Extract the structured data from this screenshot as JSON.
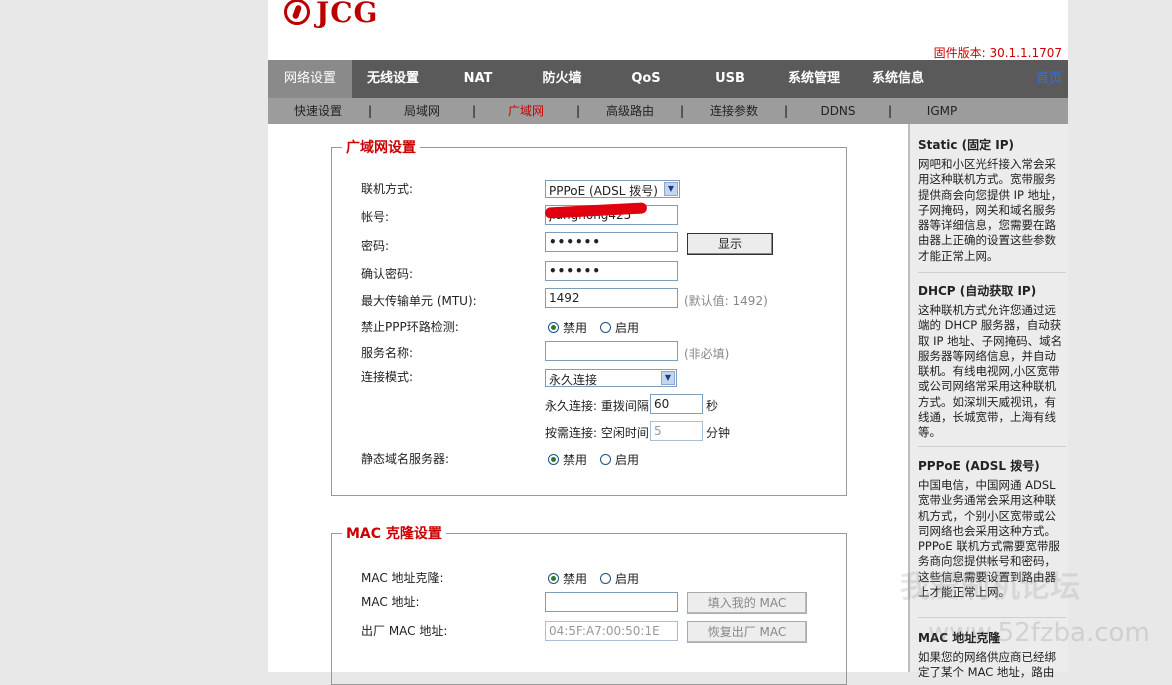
{
  "brand": {
    "logo_text": "JCG"
  },
  "firmware": "固件版本: 30.1.1.1707",
  "nav_main": [
    "网络设置",
    "无线设置",
    "NAT",
    "防火墙",
    "QoS",
    "USB",
    "系统管理",
    "系统信息"
  ],
  "nav_home": "首页",
  "nav_sub": [
    "快速设置",
    "局域网",
    "广域网",
    "高级路由",
    "连接参数",
    "DDNS",
    "IGMP"
  ],
  "nav_sep": "|",
  "wan": {
    "title": "广域网设置",
    "conn_type_label": "联机方式:",
    "conn_type_value": "PPPoE (ADSL 拨号)",
    "account_label": "帐号:",
    "account_value": "jiangnong425",
    "password_label": "密码:",
    "password_value": "••••••",
    "show_button": "显示",
    "confirm_label": "确认密码:",
    "confirm_value": "••••••",
    "mtu_label": "最大传输单元 (MTU):",
    "mtu_value": "1492",
    "mtu_hint": "(默认值: 1492)",
    "ppp_label": "禁止PPP环路检测:",
    "service_label": "服务名称:",
    "service_value": "",
    "service_hint": "(非必填)",
    "mode_label": "连接模式:",
    "mode_value": "永久连接",
    "redial_label": "永久连接: 重拨间隔",
    "redial_value": "60",
    "redial_unit": "秒",
    "idle_label": "按需连接: 空闲时间",
    "idle_value": "5",
    "idle_unit": "分钟",
    "static_dns_label": "静态域名服务器:",
    "disable": "禁用",
    "enable": "启用"
  },
  "mac": {
    "title": "MAC 克隆设置",
    "clone_label": "MAC 地址克隆:",
    "addr_label": "MAC 地址:",
    "addr_value": "",
    "fill_button": "填入我的 MAC",
    "factory_label": "出厂 MAC 地址:",
    "factory_value": "04:5F:A7:00:50:1E",
    "restore_button": "恢复出厂 MAC"
  },
  "help": [
    {
      "title": "Static (固定 IP)",
      "text": "网吧和小区光纤接入常会采用这种联机方式。宽带服务提供商会向您提供 IP 地址，子网掩码，网关和域名服务器等详细信息，您需要在路由器上正确的设置这些参数才能正常上网。"
    },
    {
      "title": "DHCP (自动获取 IP)",
      "text": "这种联机方式允许您通过远端的 DHCP 服务器，自动获取 IP 地址、子网掩码、域名服务器等网络信息，并自动联机。有线电视网,小区宽带或公司网络常采用这种联机方式。如深圳天威视讯，有线通，长城宽带，上海有线等。"
    },
    {
      "title": "PPPoE (ADSL 拨号)",
      "text": "中国电信，中国网通 ADSL 宽带业务通常会采用这种联机方式，个别小区宽带或公司网络也会采用这种方式。PPPoE 联机方式需要宽带服务商向您提供帐号和密码，这些信息需要设置到路由器上才能正常上网。"
    },
    {
      "title": "MAC 地址克隆",
      "text": "如果您的网络供应商已经绑定了某个 MAC 地址，路由"
    }
  ],
  "watermark": {
    "text1": "我爱刷机论坛",
    "text2": "www.52fzba.com"
  }
}
